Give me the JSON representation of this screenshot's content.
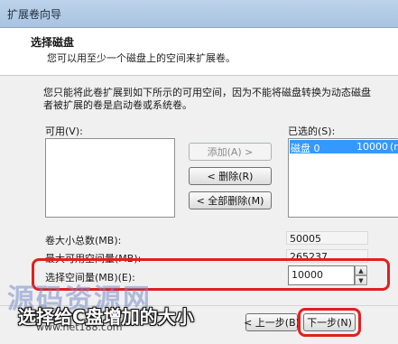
{
  "window": {
    "title": "扩展卷向导"
  },
  "header": {
    "title": "选择磁盘",
    "subtitle": "您可以用至少一个磁盘上的空间来扩展卷。"
  },
  "description": {
    "line1": "您只能将此卷扩展到如下所示的可用空间，因为不能将磁盘转换为动态磁盘",
    "line2": "者被扩展的卷是启动卷或系统卷。"
  },
  "available": {
    "label": "可用(V):",
    "items": []
  },
  "selected": {
    "label": "已选的(S):",
    "items": [
      {
        "name": "磁盘 0",
        "size": "10000",
        "extra": "(n"
      }
    ]
  },
  "buttons": {
    "add": "添加(A) >",
    "remove": "< 删除(R)",
    "remove_all": "< 全部删除(M)",
    "back": "< 上一步(B)",
    "next": "下一步(N)"
  },
  "fields": {
    "total_label": "卷大小总数(MB):",
    "total_value": "50005",
    "max_label": "最大可用空间量(MB):",
    "max_value": "265237",
    "select_label": "选择空间量(MB)(E):",
    "select_value": "10000"
  },
  "overlay": {
    "watermark": "源码资源网",
    "watermark_url": "www.net188.com",
    "caption": "选择给C盘增加的大小",
    "highlight_color": "#e0201e"
  }
}
